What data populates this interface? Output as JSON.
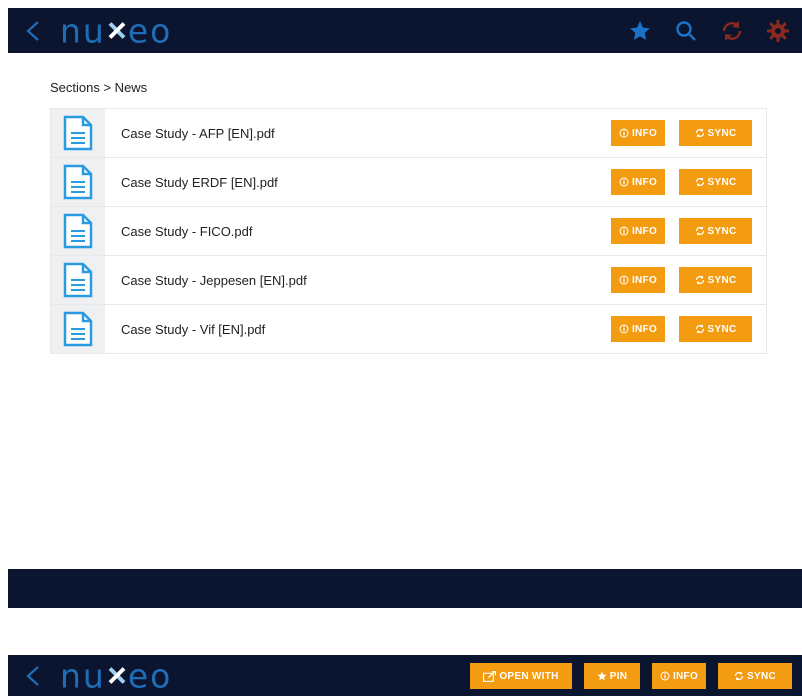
{
  "app": {
    "logo_text_left": "nu",
    "logo_text_right": "eo"
  },
  "header": {
    "icons": [
      "star-icon",
      "search-icon",
      "sync-icon",
      "gear-icon"
    ],
    "colors": {
      "bar": "#0b1530",
      "brand_blue": "#1f6db7",
      "star": "#1a73c8",
      "sync": "#8a2a1e",
      "gear": "#8a2a1e"
    }
  },
  "breadcrumb": {
    "text": "Sections > News"
  },
  "documents": [
    {
      "name": "Case Study - AFP [EN].pdf"
    },
    {
      "name": "Case Study ERDF [EN].pdf"
    },
    {
      "name": "Case Study - FICO.pdf"
    },
    {
      "name": "Case Study - Jeppesen [EN].pdf"
    },
    {
      "name": "Case Study - Vif [EN].pdf"
    }
  ],
  "row_buttons": {
    "info_label": "INFO",
    "sync_label": "SYNC"
  },
  "bottom_bar": {
    "open_with_label": "OPEN WITH",
    "pin_label": "PIN",
    "info_label": "INFO",
    "sync_label": "SYNC"
  },
  "accent": "#f39c12"
}
